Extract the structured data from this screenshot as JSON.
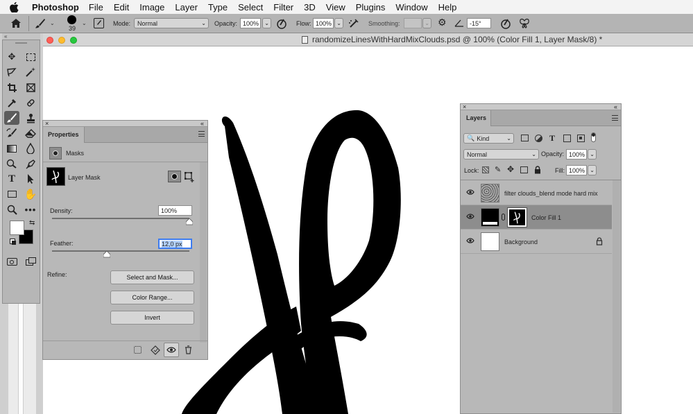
{
  "menu": {
    "app_name": "Photoshop",
    "items": [
      "File",
      "Edit",
      "Image",
      "Layer",
      "Type",
      "Select",
      "Filter",
      "3D",
      "View",
      "Plugins",
      "Window",
      "Help"
    ]
  },
  "options": {
    "brush_size": "39",
    "mode_label": "Mode:",
    "mode_value": "Normal",
    "opacity_label": "Opacity:",
    "opacity_value": "100%",
    "flow_label": "Flow:",
    "flow_value": "100%",
    "smoothing_label": "Smoothing:",
    "angle_value": "-15°"
  },
  "document": {
    "title": "randomizeLinesWithHardMixClouds.psd @ 100% (Color Fill 1, Layer Mask/8) *"
  },
  "properties": {
    "tab": "Properties",
    "section": "Masks",
    "mask_label": "Layer Mask",
    "density_label": "Density:",
    "density_value": "100%",
    "density_fraction": 1.0,
    "feather_label": "Feather:",
    "feather_value": "12,0 px",
    "feather_fraction": 0.4,
    "refine_label": "Refine:",
    "select_mask_button": "Select and Mask...",
    "color_range_button": "Color Range...",
    "invert_button": "Invert"
  },
  "layers": {
    "tab": "Layers",
    "kind_value": "Kind",
    "blend_value": "Normal",
    "opacity_label": "Opacity:",
    "opacity_value": "100%",
    "lock_label": "Lock:",
    "fill_label": "Fill:",
    "fill_value": "100%",
    "items": [
      {
        "name": "filter clouds_blend mode hard mix"
      },
      {
        "name": "Color Fill 1"
      },
      {
        "name": "Background"
      }
    ]
  },
  "colors": {
    "selected_layer_bg": "#8d8d8d",
    "panel_bg": "#b8b8b8",
    "accent_focus": "#3d7cf0"
  }
}
